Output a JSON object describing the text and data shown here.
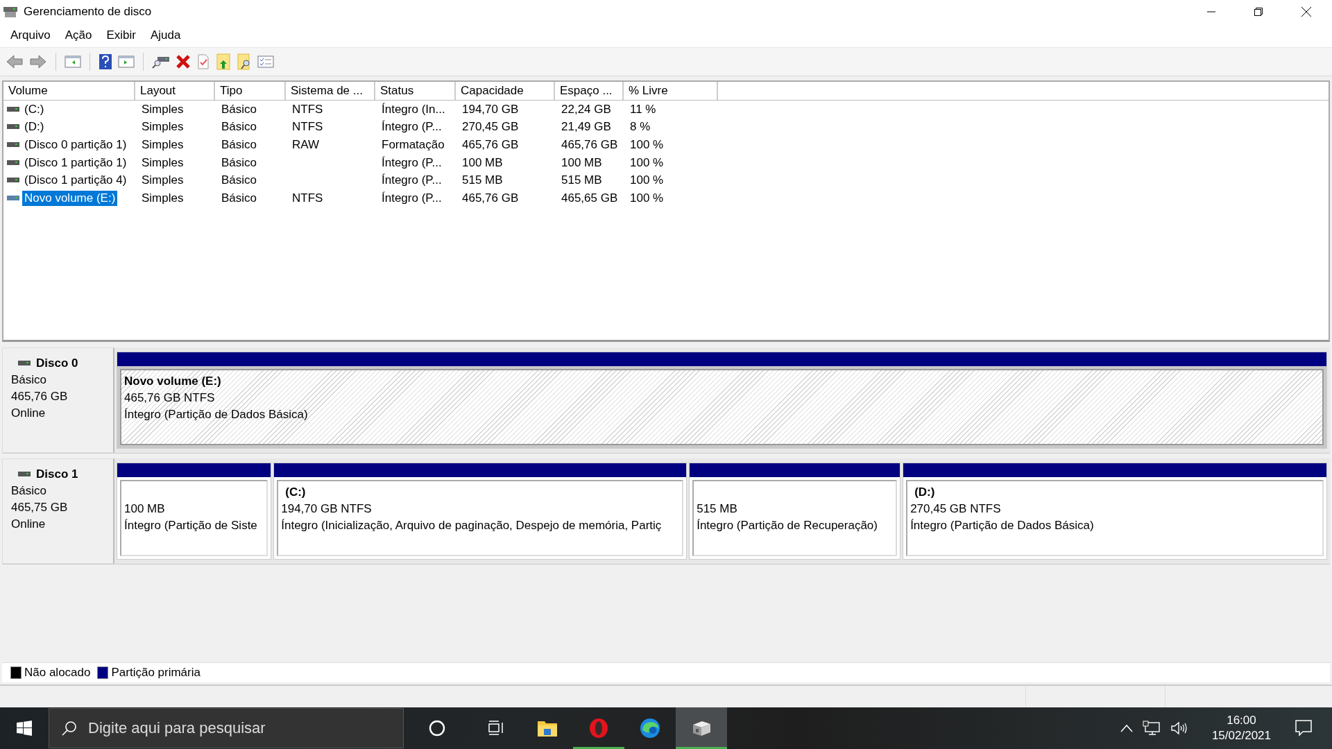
{
  "window": {
    "title": "Gerenciamento de disco"
  },
  "menu": [
    "Arquivo",
    "Ação",
    "Exibir",
    "Ajuda"
  ],
  "table": {
    "columns": [
      "Volume",
      "Layout",
      "Tipo",
      "Sistema de ...",
      "Status",
      "Capacidade",
      "Espaço ...",
      "% Livre"
    ],
    "rows": [
      {
        "cells": [
          "(C:)",
          "Simples",
          "Básico",
          "NTFS",
          "Íntegro (In...",
          "194,70 GB",
          "22,24 GB",
          "11 %"
        ],
        "selected": false
      },
      {
        "cells": [
          "(D:)",
          "Simples",
          "Básico",
          "NTFS",
          "Íntegro (P...",
          "270,45 GB",
          "21,49 GB",
          "8 %"
        ],
        "selected": false
      },
      {
        "cells": [
          "(Disco 0 partição 1)",
          "Simples",
          "Básico",
          "RAW",
          "Formatação",
          "465,76 GB",
          "465,76 GB",
          "100 %"
        ],
        "selected": false
      },
      {
        "cells": [
          "(Disco 1 partição 1)",
          "Simples",
          "Básico",
          "",
          "Íntegro (P...",
          "100 MB",
          "100 MB",
          "100 %"
        ],
        "selected": false
      },
      {
        "cells": [
          "(Disco 1 partição 4)",
          "Simples",
          "Básico",
          "",
          "Íntegro (P...",
          "515 MB",
          "515 MB",
          "100 %"
        ],
        "selected": false
      },
      {
        "cells": [
          "Novo volume (E:)",
          "Simples",
          "Básico",
          "NTFS",
          "Íntegro (P...",
          "465,76 GB",
          "465,65 GB",
          "100 %"
        ],
        "selected": true
      }
    ]
  },
  "disks": [
    {
      "name": "Disco 0",
      "type": "Básico",
      "size": "465,76 GB",
      "status": "Online",
      "partitions": [
        {
          "label": "Novo volume  (E:)",
          "size": "465,76 GB NTFS",
          "status": "Íntegro (Partição de Dados Básica)",
          "selected": true
        }
      ]
    },
    {
      "name": "Disco 1",
      "type": "Básico",
      "size": "465,75 GB",
      "status": "Online",
      "partitions": [
        {
          "size": "100 MB",
          "status": "Íntegro (Partição de Siste",
          "selected": false
        },
        {
          "label": "(C:)",
          "size": "194,70 GB NTFS",
          "status": "Íntegro (Inicialização, Arquivo de paginação, Despejo de memória, Partiç",
          "selected": false
        },
        {
          "size": "515 MB",
          "status": "Íntegro (Partição de Recuperação)",
          "selected": false
        },
        {
          "label": "(D:)",
          "size": "270,45 GB NTFS",
          "status": "Íntegro (Partição de Dados Básica)",
          "selected": false
        }
      ]
    }
  ],
  "legend": [
    {
      "label": "Não alocado",
      "color": "#000000"
    },
    {
      "label": "Partição primária",
      "color": "#000080"
    }
  ],
  "taskbar": {
    "search": {
      "placeholder": "Digite aqui para pesquisar"
    },
    "apps": [
      {
        "kind": "explorer",
        "running": false,
        "selected": false
      },
      {
        "kind": "opera",
        "running": true,
        "selected": false
      },
      {
        "kind": "edge",
        "running": false,
        "selected": false
      },
      {
        "kind": "diskmgmt",
        "running": true,
        "selected": true
      }
    ],
    "time": "16:00",
    "date": "15/02/2021"
  }
}
